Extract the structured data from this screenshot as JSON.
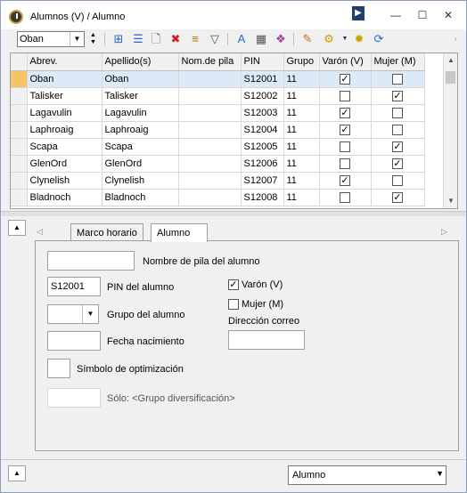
{
  "window": {
    "title": "Alumnos (V) / Alumno"
  },
  "toolbar": {
    "selector_value": "Oban",
    "icons": [
      "grid-add-icon",
      "grid-rows-icon",
      "new-icon",
      "delete-icon",
      "sort-icon",
      "filter-icon",
      "font-icon",
      "fields-icon",
      "colors-icon",
      "settings-icon",
      "tools-icon",
      "gear-icon",
      "refresh-icon"
    ]
  },
  "grid": {
    "columns": [
      "Abrev.",
      "Apellido(s)",
      "Nom.de pila",
      "PIN",
      "Grupo",
      "Varón (V)",
      "Mujer (M)"
    ],
    "rows": [
      {
        "abrev": "Oban",
        "apellido": "Oban",
        "nombre": "",
        "pin": "S12001",
        "grupo": "11",
        "varon": true,
        "mujer": false
      },
      {
        "abrev": "Talisker",
        "apellido": "Talisker",
        "nombre": "",
        "pin": "S12002",
        "grupo": "11",
        "varon": false,
        "mujer": true
      },
      {
        "abrev": "Lagavulin",
        "apellido": "Lagavulin",
        "nombre": "",
        "pin": "S12003",
        "grupo": "11",
        "varon": true,
        "mujer": false
      },
      {
        "abrev": "Laphroaig",
        "apellido": "Laphroaig",
        "nombre": "",
        "pin": "S12004",
        "grupo": "11",
        "varon": true,
        "mujer": false
      },
      {
        "abrev": "Scapa",
        "apellido": "Scapa",
        "nombre": "",
        "pin": "S12005",
        "grupo": "11",
        "varon": false,
        "mujer": true
      },
      {
        "abrev": "GlenOrd",
        "apellido": "GlenOrd",
        "nombre": "",
        "pin": "S12006",
        "grupo": "11",
        "varon": false,
        "mujer": true
      },
      {
        "abrev": "Clynelish",
        "apellido": "Clynelish",
        "nombre": "",
        "pin": "S12007",
        "grupo": "11",
        "varon": true,
        "mujer": false
      },
      {
        "abrev": "Bladnoch",
        "apellido": "Bladnoch",
        "nombre": "",
        "pin": "S12008",
        "grupo": "11",
        "varon": false,
        "mujer": true
      }
    ]
  },
  "tabs": [
    {
      "label": "Marco horario"
    },
    {
      "label": "Alumno"
    }
  ],
  "form": {
    "nombre_value": "",
    "nombre_label": "Nombre de pila del alumno",
    "pin_value": "S12001",
    "pin_label": "PIN del alumno",
    "grupo_label": "Grupo del alumno",
    "fecha_label": "Fecha nacimiento",
    "simbolo_label": "Símbolo de optimización",
    "solo_label": "Sólo: <Grupo diversificación>",
    "varon_label": "Varón (V)",
    "mujer_label": "Mujer (M)",
    "correo_label": "Dirección correo"
  },
  "bottom": {
    "view_select": "Alumno"
  }
}
